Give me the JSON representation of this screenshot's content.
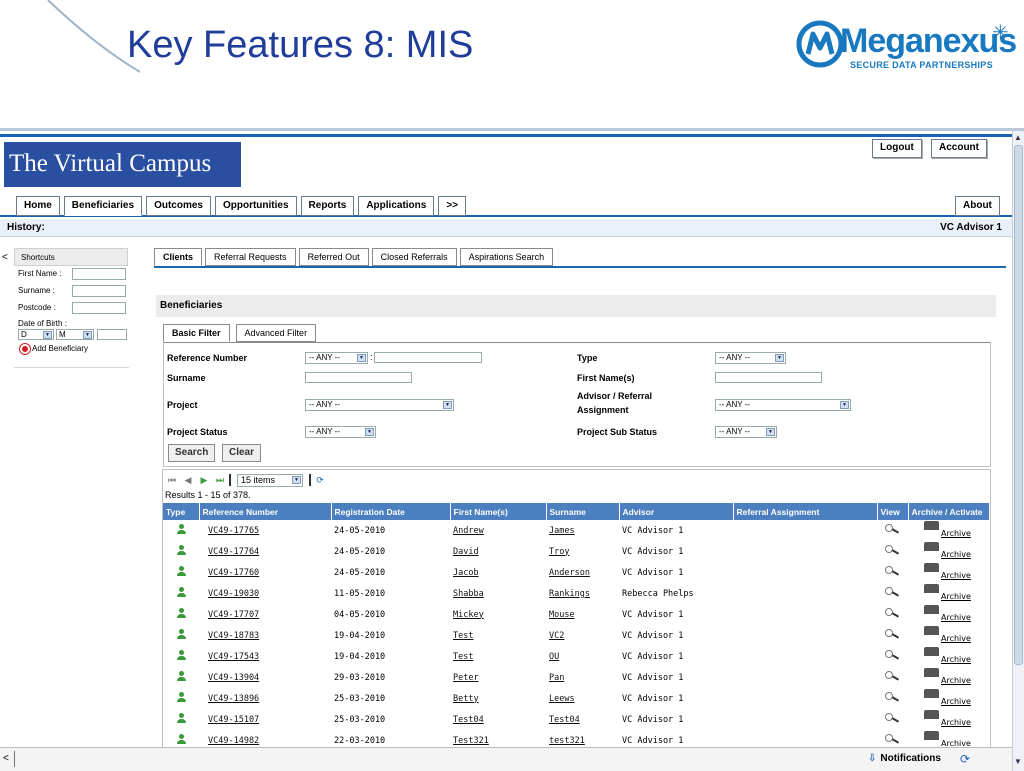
{
  "slide": {
    "title": "Key Features 8: MIS",
    "logo_text": "Meganexus",
    "logo_tagline": "SECURE DATA PARTNERSHIPS"
  },
  "app": {
    "brand": "The Virtual Campus",
    "top_buttons": {
      "logout": "Logout",
      "account": "Account"
    },
    "nav": [
      "Home",
      "Beneficiaries",
      "Outcomes",
      "Opportunities",
      "Reports",
      "Applications",
      ">>"
    ],
    "about": "About",
    "history_label": "History:",
    "user": "VC Advisor 1"
  },
  "sidebar": {
    "collapse": "<",
    "title": "Shortcuts",
    "first_name": "First Name :",
    "surname": "Surname :",
    "postcode": "Postcode :",
    "dob": "Date of Birth :",
    "dob_day": "D",
    "dob_month": "M",
    "add": "Add Beneficiary"
  },
  "tabs": [
    "Clients",
    "Referral Requests",
    "Referred Out",
    "Closed Referrals",
    "Aspirations Search"
  ],
  "panel": {
    "title": "Beneficiaries",
    "filter_tabs": [
      "Basic Filter",
      "Advanced Filter"
    ]
  },
  "filter": {
    "reference_number": "Reference Number",
    "surname": "Surname",
    "project": "Project",
    "project_status": "Project Status",
    "type": "Type",
    "first_names": "First Name(s)",
    "advisor_referral": "Advisor / Referral Assignment",
    "project_sub_status": "Project Sub Status",
    "any_short": "-- ANY --",
    "any_long": "-- ANY --",
    "ref_colon": ":",
    "search": "Search",
    "clear": "Clear"
  },
  "grid": {
    "page_size": "15 items",
    "results": "Results 1 - 15 of 378.",
    "columns": [
      "Type",
      "Reference Number",
      "Registration Date",
      "First Name(s)",
      "Surname",
      "Advisor",
      "Referral Assignment",
      "View",
      "Archive / Activate"
    ],
    "archive_label": "Archive",
    "rows": [
      {
        "ref": "VC49-17765",
        "date": "24-05-2010",
        "first": "Andrew",
        "surname": "James",
        "advisor": "VC Advisor 1"
      },
      {
        "ref": "VC49-17764",
        "date": "24-05-2010",
        "first": "David",
        "surname": "Troy",
        "advisor": "VC Advisor 1"
      },
      {
        "ref": "VC49-17760",
        "date": "24-05-2010",
        "first": "Jacob",
        "surname": "Anderson",
        "advisor": "VC Advisor 1"
      },
      {
        "ref": "VC49-19030",
        "date": "11-05-2010",
        "first": "Shabba",
        "surname": "Rankings",
        "advisor": "Rebecca Phelps"
      },
      {
        "ref": "VC49-17707",
        "date": "04-05-2010",
        "first": "Mickey",
        "surname": "Mouse",
        "advisor": "VC Advisor 1"
      },
      {
        "ref": "VC49-18783",
        "date": "19-04-2010",
        "first": "Test",
        "surname": "VC2",
        "advisor": "VC Advisor 1"
      },
      {
        "ref": "VC49-17543",
        "date": "19-04-2010",
        "first": "Test",
        "surname": "OU",
        "advisor": "VC Advisor 1"
      },
      {
        "ref": "VC49-13904",
        "date": "29-03-2010",
        "first": "Peter",
        "surname": "Pan",
        "advisor": "VC Advisor 1"
      },
      {
        "ref": "VC49-13896",
        "date": "25-03-2010",
        "first": "Betty",
        "surname": "Leews",
        "advisor": "VC Advisor 1"
      },
      {
        "ref": "VC49-15107",
        "date": "25-03-2010",
        "first": "Test04",
        "surname": "Test04",
        "advisor": "VC Advisor 1"
      },
      {
        "ref": "VC49-14982",
        "date": "22-03-2010",
        "first": "Test321",
        "surname": "test321",
        "advisor": "VC Advisor 1"
      }
    ]
  },
  "bottom": {
    "collapse": "<",
    "notifications": "Notifications"
  },
  "colors": {
    "title_blue": "#1f3d99",
    "brand_blue": "#2a4fa1",
    "accent_blue": "#1b63b3",
    "grid_header": "#4b7fc0",
    "person_green": "#3a9a3a"
  }
}
